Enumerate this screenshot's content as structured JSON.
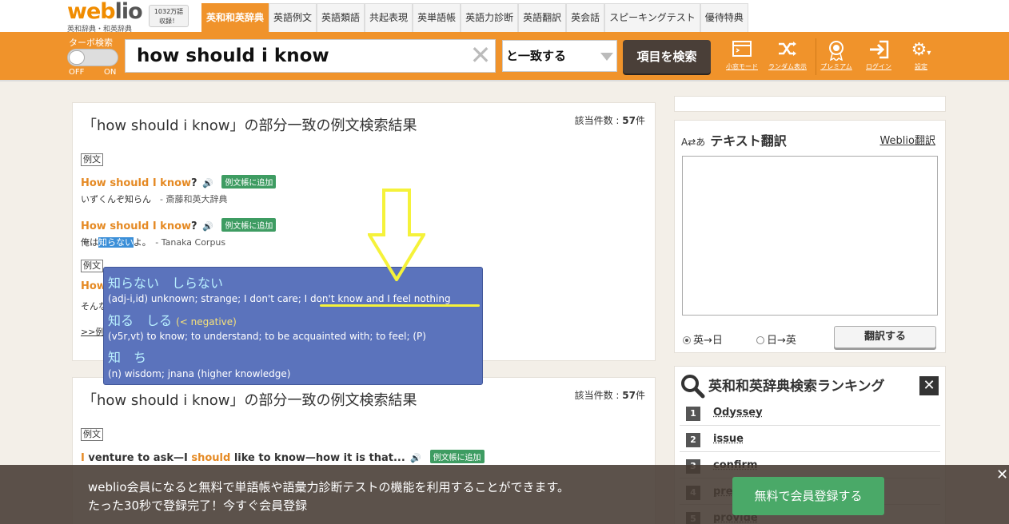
{
  "header": {
    "logo_main": "weblio",
    "logo_sub": "英和辞典・和英辞典",
    "word_count_line1": "1032万語",
    "word_count_line2": "収録！",
    "nav": [
      "英和和英辞典",
      "英語例文",
      "英語類語",
      "共起表現",
      "英単語帳",
      "英語力診断",
      "英語翻訳",
      "英会話",
      "スピーキングテスト",
      "優待特典"
    ],
    "active_nav_index": 0
  },
  "search": {
    "turbo_label": "ターボ検索",
    "toggle_off": "OFF",
    "toggle_on": "ON",
    "query": "how should i know",
    "match_mode": "と一致する",
    "search_button": "項目を検索",
    "tools": [
      {
        "icon": "window-icon",
        "label": "小窓モード"
      },
      {
        "icon": "shuffle-icon",
        "label": "ランダム表示"
      },
      {
        "icon": "premium-icon",
        "label": "プレミアム"
      },
      {
        "icon": "login-icon",
        "label": "ログイン"
      },
      {
        "icon": "gear-icon",
        "label": "設定"
      }
    ]
  },
  "results": [
    {
      "title": "「how should i know」の部分一致の例文検索結果",
      "count_label": "該当件数 : ",
      "count": "57",
      "count_unit": "件",
      "tag": "例文",
      "examples": [
        {
          "hl": "How should I know",
          "rest": "?",
          "add": "例文帳に追加",
          "trans": "いずくんぞ知らん",
          "source": "- 斎藤和英大辞典"
        },
        {
          "hl": "How should I know",
          "rest": "?",
          "add": "例文帳に追加",
          "trans_pre": "俺は",
          "trans_sel": "知らない",
          "trans_post": "よ。",
          "source": "- Tanaka Corpus"
        }
      ],
      "tag2": "例文",
      "partial_line": "How",
      "partial_trans": "そんな",
      "more": ">>例"
    },
    {
      "title": "「how should i know」の部分一致の例文検索結果",
      "count_label": "該当件数 : ",
      "count": "57",
      "count_unit": "件",
      "tag": "例文",
      "example": {
        "a": "I",
        "b": " venture to ask—I ",
        "c": "should",
        "d": " like to know—how it is that...",
        "add": "例文帳に追加"
      }
    }
  ],
  "popup": {
    "entries": [
      {
        "head": "知らない　しらない",
        "neg": "",
        "sense": "(adj-i,id) unknown; strange; I don't care; I don't know and I feel nothing"
      },
      {
        "head": "知る　しる",
        "neg": "(< negative)",
        "sense": "(v5r,vt) to know; to understand; to be acquainted with; to feel; (P)"
      },
      {
        "head": "知　ち",
        "neg": "",
        "sense": "(n) wisdom; jnana (higher knowledge)"
      }
    ]
  },
  "translate": {
    "title": "テキスト翻訳",
    "link": "Weblio翻訳",
    "radio_en_ja": "英→日",
    "radio_ja_en": "日→英",
    "button": "翻訳する"
  },
  "ranking": {
    "title": "英和和英辞典検索ランキング",
    "close": "✕",
    "items": [
      {
        "rank": "1",
        "word": "Odyssey"
      },
      {
        "rank": "2",
        "word": "issue"
      },
      {
        "rank": "3",
        "word": "confirm"
      },
      {
        "rank": "4",
        "word": "present"
      },
      {
        "rank": "5",
        "word": "provide"
      }
    ]
  },
  "banner": {
    "line1": "weblio会員になると無料で単語帳や語彙力診断テストの機能を利用することができます。",
    "line2": "たった30秒で登録完了！今すぐ会員登録",
    "button": "無料で会員登録する",
    "close": "✕"
  },
  "colors": {
    "accent": "#f0932b",
    "popup": "#5b73bc",
    "highlight": "#e58a24",
    "badge": "#3e9c62"
  }
}
